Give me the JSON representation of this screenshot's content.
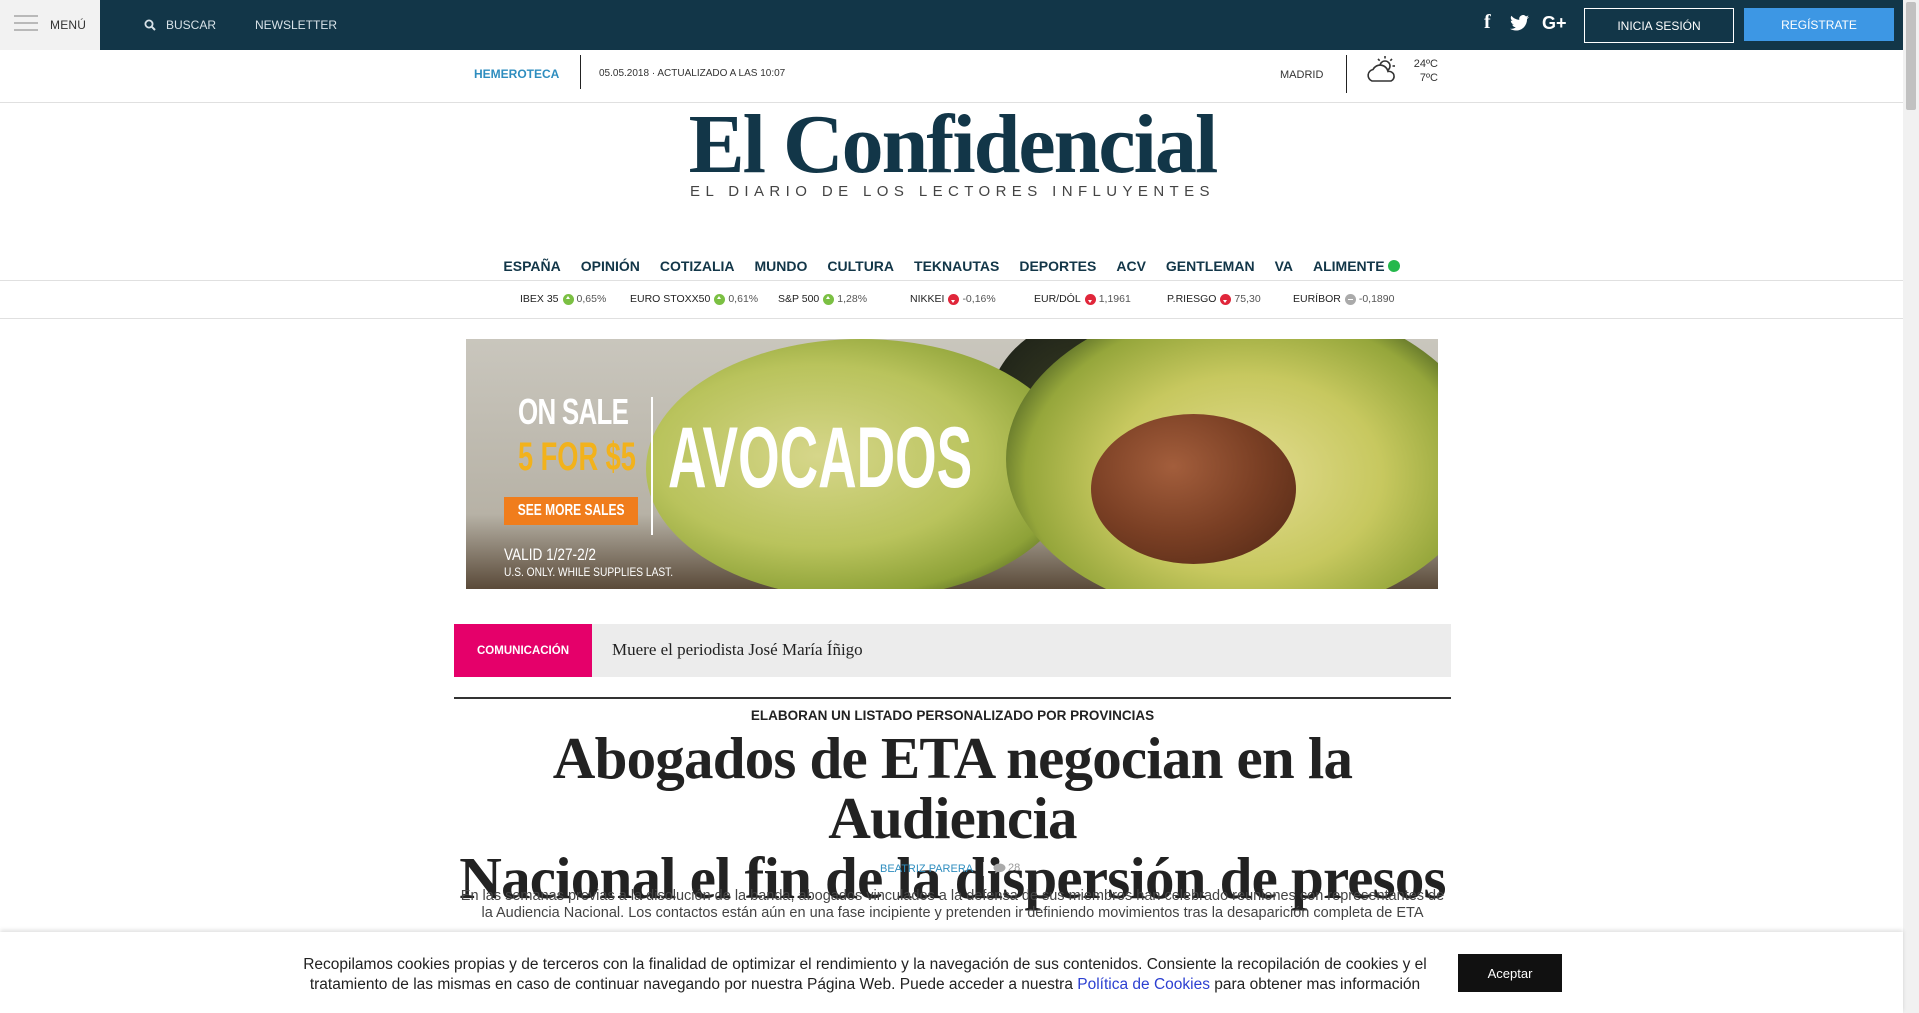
{
  "header": {
    "menu_label": "MENÚ",
    "search_label": "BUSCAR",
    "newsletter_label": "NEWSLETTER",
    "social_icons": [
      "facebook-icon",
      "twitter-icon",
      "google-plus-icon"
    ],
    "google_plus_label": "G+",
    "login_label": "INICIA SESIÓN",
    "register_label": "REGÍSTRATE",
    "colors": {
      "topbar": "#123648",
      "register": "#3d97e4"
    }
  },
  "datestrip": {
    "hemeroteca": "HEMEROTECA",
    "date": "05.05.2018 · ACTUALIZADO A LAS  10:07",
    "city": "MADRID",
    "temp_high": "24ºC",
    "temp_low": "7ºC",
    "weather_icon": "partly-cloudy-icon"
  },
  "masthead": {
    "logo": "El Confidencial",
    "tagline": "EL DIARIO DE LOS LECTORES INFLUYENTES"
  },
  "nav": {
    "items": [
      "ESPAÑA",
      "OPINIÓN",
      "COTIZALIA",
      "MUNDO",
      "CULTURA",
      "TEKNAUTAS",
      "DEPORTES",
      "ACV",
      "GENTLEMAN",
      "VA",
      "ALIMENTE"
    ]
  },
  "markets": [
    {
      "name": "IBEX 35",
      "trend": "up",
      "value": "0,65%"
    },
    {
      "name": "EURO STOXX50",
      "trend": "up",
      "value": "0,61%"
    },
    {
      "name": "S&P 500",
      "trend": "up",
      "value": "1,28%"
    },
    {
      "name": "NIKKEI",
      "trend": "down",
      "value": "-0,16%"
    },
    {
      "name": "EUR/DÓL",
      "trend": "down",
      "value": "1,1961"
    },
    {
      "name": "P.RIESGO",
      "trend": "down",
      "value": "75,30"
    },
    {
      "name": "EURÍBOR",
      "trend": "flat",
      "value": "-0,1890"
    }
  ],
  "banner": {
    "on_sale": "ON SALE",
    "offer": "5 FOR $5",
    "cta": "SEE MORE SALES",
    "product": "AVOCADOS",
    "valid": "VALID 1/27-2/2",
    "note": "U.S. ONLY. WHILE SUPPLIES LAST."
  },
  "breaking": {
    "tag": "COMUNICACIÓN",
    "text": "Muere el periodista José María Íñigo"
  },
  "article": {
    "kicker": "ELABORAN UN LISTADO PERSONALIZADO POR PROVINCIAS",
    "headline_line1": "Abogados de ETA negocian en la Audiencia",
    "headline_line2": "Nacional el fin de la dispersión de presos",
    "author": "BEATRIZ PARERA",
    "comments": "28",
    "lead": "En las semanas previas a la disolución de la banda, abogados vinculados a la defensa de sus miembros han celebrado reuniones con representantes de la Audiencia Nacional. Los contactos están aún en una fase incipiente y pretenden ir definiendo movimientos tras la desaparición completa de ETA"
  },
  "cookies": {
    "text_before": "Recopilamos cookies propias y de terceros con la finalidad de optimizar el rendimiento y la navegación de sus contenidos. Consiente la recopilación de cookies y el tratamiento de las mismas en caso de continuar navegando por nuestra Página Web. Puede acceder a nuestra ",
    "link": "Política de Cookies",
    "text_after": " para obtener mas información",
    "accept_label": "Aceptar"
  }
}
